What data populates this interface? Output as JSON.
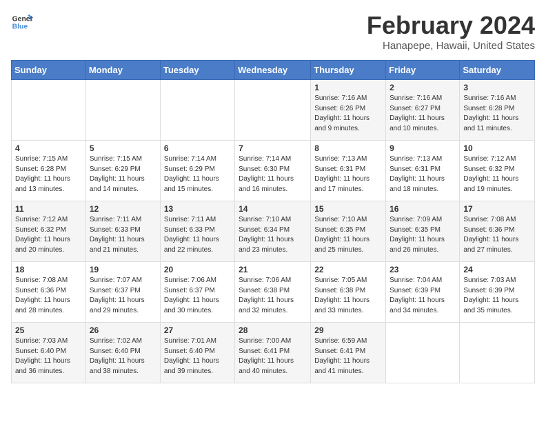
{
  "logo": {
    "line1": "General",
    "line2": "Blue"
  },
  "title": "February 2024",
  "subtitle": "Hanapepe, Hawaii, United States",
  "headers": [
    "Sunday",
    "Monday",
    "Tuesday",
    "Wednesday",
    "Thursday",
    "Friday",
    "Saturday"
  ],
  "weeks": [
    [
      {
        "day": "",
        "info": ""
      },
      {
        "day": "",
        "info": ""
      },
      {
        "day": "",
        "info": ""
      },
      {
        "day": "",
        "info": ""
      },
      {
        "day": "1",
        "info": "Sunrise: 7:16 AM\nSunset: 6:26 PM\nDaylight: 11 hours\nand 9 minutes."
      },
      {
        "day": "2",
        "info": "Sunrise: 7:16 AM\nSunset: 6:27 PM\nDaylight: 11 hours\nand 10 minutes."
      },
      {
        "day": "3",
        "info": "Sunrise: 7:16 AM\nSunset: 6:28 PM\nDaylight: 11 hours\nand 11 minutes."
      }
    ],
    [
      {
        "day": "4",
        "info": "Sunrise: 7:15 AM\nSunset: 6:28 PM\nDaylight: 11 hours\nand 13 minutes."
      },
      {
        "day": "5",
        "info": "Sunrise: 7:15 AM\nSunset: 6:29 PM\nDaylight: 11 hours\nand 14 minutes."
      },
      {
        "day": "6",
        "info": "Sunrise: 7:14 AM\nSunset: 6:29 PM\nDaylight: 11 hours\nand 15 minutes."
      },
      {
        "day": "7",
        "info": "Sunrise: 7:14 AM\nSunset: 6:30 PM\nDaylight: 11 hours\nand 16 minutes."
      },
      {
        "day": "8",
        "info": "Sunrise: 7:13 AM\nSunset: 6:31 PM\nDaylight: 11 hours\nand 17 minutes."
      },
      {
        "day": "9",
        "info": "Sunrise: 7:13 AM\nSunset: 6:31 PM\nDaylight: 11 hours\nand 18 minutes."
      },
      {
        "day": "10",
        "info": "Sunrise: 7:12 AM\nSunset: 6:32 PM\nDaylight: 11 hours\nand 19 minutes."
      }
    ],
    [
      {
        "day": "11",
        "info": "Sunrise: 7:12 AM\nSunset: 6:32 PM\nDaylight: 11 hours\nand 20 minutes."
      },
      {
        "day": "12",
        "info": "Sunrise: 7:11 AM\nSunset: 6:33 PM\nDaylight: 11 hours\nand 21 minutes."
      },
      {
        "day": "13",
        "info": "Sunrise: 7:11 AM\nSunset: 6:33 PM\nDaylight: 11 hours\nand 22 minutes."
      },
      {
        "day": "14",
        "info": "Sunrise: 7:10 AM\nSunset: 6:34 PM\nDaylight: 11 hours\nand 23 minutes."
      },
      {
        "day": "15",
        "info": "Sunrise: 7:10 AM\nSunset: 6:35 PM\nDaylight: 11 hours\nand 25 minutes."
      },
      {
        "day": "16",
        "info": "Sunrise: 7:09 AM\nSunset: 6:35 PM\nDaylight: 11 hours\nand 26 minutes."
      },
      {
        "day": "17",
        "info": "Sunrise: 7:08 AM\nSunset: 6:36 PM\nDaylight: 11 hours\nand 27 minutes."
      }
    ],
    [
      {
        "day": "18",
        "info": "Sunrise: 7:08 AM\nSunset: 6:36 PM\nDaylight: 11 hours\nand 28 minutes."
      },
      {
        "day": "19",
        "info": "Sunrise: 7:07 AM\nSunset: 6:37 PM\nDaylight: 11 hours\nand 29 minutes."
      },
      {
        "day": "20",
        "info": "Sunrise: 7:06 AM\nSunset: 6:37 PM\nDaylight: 11 hours\nand 30 minutes."
      },
      {
        "day": "21",
        "info": "Sunrise: 7:06 AM\nSunset: 6:38 PM\nDaylight: 11 hours\nand 32 minutes."
      },
      {
        "day": "22",
        "info": "Sunrise: 7:05 AM\nSunset: 6:38 PM\nDaylight: 11 hours\nand 33 minutes."
      },
      {
        "day": "23",
        "info": "Sunrise: 7:04 AM\nSunset: 6:39 PM\nDaylight: 11 hours\nand 34 minutes."
      },
      {
        "day": "24",
        "info": "Sunrise: 7:03 AM\nSunset: 6:39 PM\nDaylight: 11 hours\nand 35 minutes."
      }
    ],
    [
      {
        "day": "25",
        "info": "Sunrise: 7:03 AM\nSunset: 6:40 PM\nDaylight: 11 hours\nand 36 minutes."
      },
      {
        "day": "26",
        "info": "Sunrise: 7:02 AM\nSunset: 6:40 PM\nDaylight: 11 hours\nand 38 minutes."
      },
      {
        "day": "27",
        "info": "Sunrise: 7:01 AM\nSunset: 6:40 PM\nDaylight: 11 hours\nand 39 minutes."
      },
      {
        "day": "28",
        "info": "Sunrise: 7:00 AM\nSunset: 6:41 PM\nDaylight: 11 hours\nand 40 minutes."
      },
      {
        "day": "29",
        "info": "Sunrise: 6:59 AM\nSunset: 6:41 PM\nDaylight: 11 hours\nand 41 minutes."
      },
      {
        "day": "",
        "info": ""
      },
      {
        "day": "",
        "info": ""
      }
    ]
  ]
}
